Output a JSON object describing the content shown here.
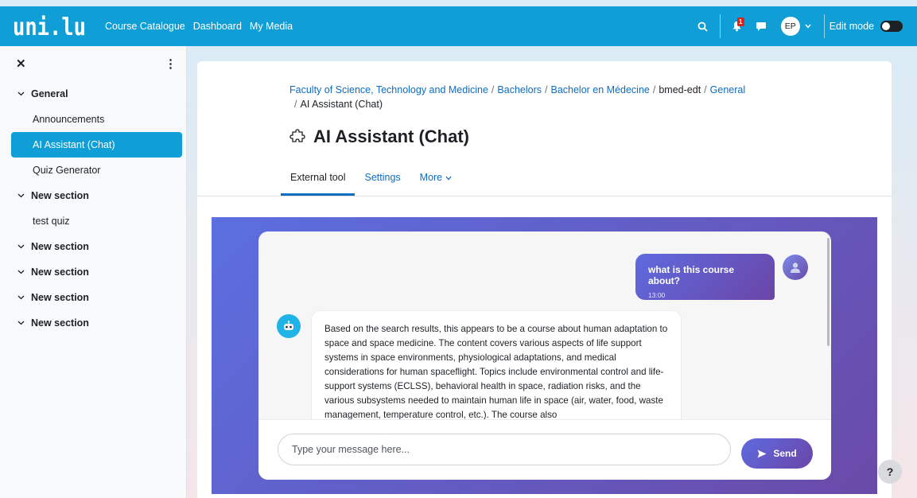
{
  "navbar": {
    "logo_text": "uni.lu",
    "links": [
      "Course Catalogue",
      "Dashboard",
      "My Media"
    ],
    "notification_count": "1",
    "user_initials": "EP",
    "edit_mode_label": "Edit mode",
    "icons": [
      "search-icon",
      "bell-icon",
      "chat-bubble-icon",
      "chevron-down-icon"
    ],
    "accent_color": "#0f9fd6"
  },
  "sidebar": {
    "items": [
      {
        "type": "section",
        "label": "General"
      },
      {
        "type": "activity",
        "label": "Announcements"
      },
      {
        "type": "activity",
        "label": "AI Assistant (Chat)",
        "active": true
      },
      {
        "type": "activity",
        "label": "Quiz Generator"
      },
      {
        "type": "section",
        "label": "New section"
      },
      {
        "type": "activity",
        "label": "test quiz"
      },
      {
        "type": "section",
        "label": "New section"
      },
      {
        "type": "section",
        "label": "New section"
      },
      {
        "type": "section",
        "label": "New section"
      },
      {
        "type": "section",
        "label": "New section"
      }
    ]
  },
  "breadcrumb": {
    "items": [
      "Faculty of Science, Technology and Medicine",
      "Bachelors",
      "Bachelor en Médecine",
      "bmed-edt",
      "General",
      "AI Assistant (Chat)"
    ],
    "separator": "/"
  },
  "page": {
    "title": "AI Assistant (Chat)",
    "tabs": [
      "External tool",
      "Settings",
      "More"
    ]
  },
  "chat": {
    "user_message": "what is this course about?",
    "user_time": "13:00",
    "bot_message": "Based on the search results, this appears to be a course about human adaptation to space and space medicine. The content covers various aspects of life support systems in space environments, physiological adaptations, and medical considerations for human spaceflight. Topics include environmental control and life-support systems (ECLSS), behavioral health in space, radiation risks, and the various subsystems needed to maintain human life in space (air, water, food, waste management, temperature control, etc.). The course also",
    "input_placeholder": "Type your message here...",
    "send_label": "Send"
  },
  "help": {
    "label": "?"
  }
}
